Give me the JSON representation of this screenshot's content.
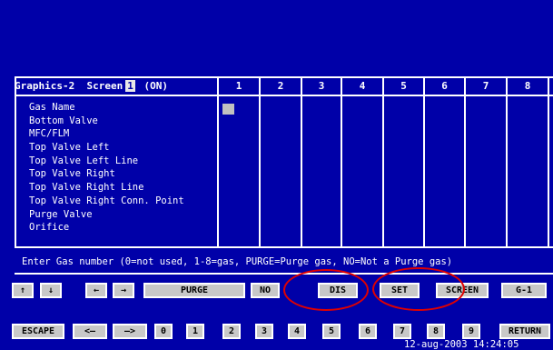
{
  "screen": {
    "title_prefix": "Graphics-2  Screen",
    "number": "1",
    "state": "(ON)"
  },
  "columns": [
    "1",
    "2",
    "3",
    "4",
    "5",
    "6",
    "7",
    "8"
  ],
  "rows": [
    "Gas Name",
    "Bottom Valve",
    "MFC/FLM",
    "Top Valve Left",
    "Top Valve Left Line",
    "Top Valve Right",
    "Top Valve Right Line",
    "Top Valve Right Conn. Point",
    "Purge Valve",
    "Orifice"
  ],
  "message": "Enter Gas number (0=not used, 1-8=gas, PURGE=Purge gas, NO=Not a Purge gas)",
  "function_bar": {
    "up": "↑",
    "down": "↓",
    "left": "←",
    "right": "→",
    "purge": "PURGE",
    "no": "NO",
    "dis": "DIS",
    "set": "SET",
    "screen": "SCREEN",
    "g1": "G-1"
  },
  "keys": {
    "escape": "ESCAPE",
    "back": "<—",
    "forward": "—>",
    "digits": [
      "0",
      "1",
      "2",
      "3",
      "4",
      "5",
      "6",
      "7",
      "8",
      "9"
    ],
    "return": "RETURN"
  },
  "status": {
    "date": "12-aug-2003",
    "time": "14:24:05"
  },
  "colors": {
    "background": "#0000a8",
    "annotation": "#e00000"
  }
}
